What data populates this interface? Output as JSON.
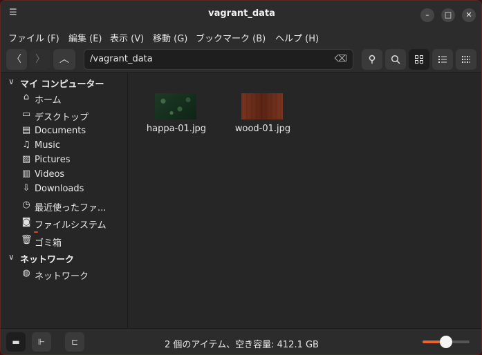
{
  "window": {
    "title": "vagrant_data"
  },
  "menubar": {
    "items": [
      "ファイル (F)",
      "編集 (E)",
      "表示 (V)",
      "移動 (G)",
      "ブックマーク (B)",
      "ヘルプ (H)"
    ]
  },
  "toolbar": {
    "path": "/vagrant_data"
  },
  "sidebar": {
    "computer_header": "マイ コンピューター",
    "computer_items": [
      {
        "label": "ホーム",
        "icon": "home-icon"
      },
      {
        "label": "デスクトップ",
        "icon": "desktop-icon"
      },
      {
        "label": "Documents",
        "icon": "documents-icon"
      },
      {
        "label": "Music",
        "icon": "music-icon"
      },
      {
        "label": "Pictures",
        "icon": "pictures-icon"
      },
      {
        "label": "Videos",
        "icon": "videos-icon"
      },
      {
        "label": "Downloads",
        "icon": "downloads-icon"
      },
      {
        "label": "最近使ったファ...",
        "icon": "recent-icon"
      },
      {
        "label": "ファイルシステム",
        "icon": "filesystem-icon"
      },
      {
        "label": "ゴミ箱",
        "icon": "trash-icon"
      }
    ],
    "network_header": "ネットワーク",
    "network_items": [
      {
        "label": "ネットワーク",
        "icon": "network-icon"
      }
    ]
  },
  "files": [
    {
      "name": "happa-01.jpg",
      "thumb_colors": [
        "#1d3a26",
        "#0f2416"
      ]
    },
    {
      "name": "wood-01.jpg",
      "thumb_colors": [
        "#7a3520",
        "#5a2414"
      ]
    }
  ],
  "statusbar": {
    "status": "2 個のアイテム、空き容量: 412.1 GB",
    "zoom_level": 0.5
  },
  "colors": {
    "accent": "#e9642e",
    "background": "#262626"
  }
}
